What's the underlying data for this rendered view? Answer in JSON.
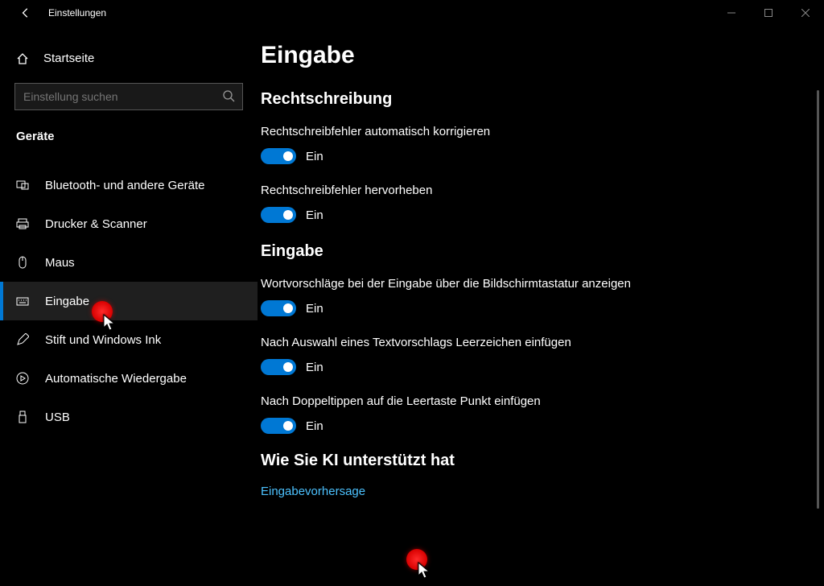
{
  "titlebar": {
    "title": "Einstellungen"
  },
  "sidebar": {
    "home": "Startseite",
    "search_placeholder": "Einstellung suchen",
    "group": "Geräte",
    "items": [
      {
        "label": "Bluetooth- und andere Geräte"
      },
      {
        "label": "Drucker & Scanner"
      },
      {
        "label": "Maus"
      },
      {
        "label": "Eingabe"
      },
      {
        "label": "Stift und Windows Ink"
      },
      {
        "label": "Automatische Wiedergabe"
      },
      {
        "label": "USB"
      }
    ]
  },
  "main": {
    "title": "Eingabe",
    "section_spelling": "Rechtschreibung",
    "spelling_autocorrect": "Rechtschreibfehler automatisch korrigieren",
    "spelling_highlight": "Rechtschreibfehler hervorheben",
    "section_typing": "Eingabe",
    "typing_suggestions": "Wortvorschläge bei der Eingabe über die Bildschirmtastatur anzeigen",
    "typing_space_after": "Nach Auswahl eines Textvorschlags Leerzeichen einfügen",
    "typing_double_tap": "Nach Doppeltippen auf die Leertaste Punkt einfügen",
    "section_ai": "Wie Sie KI unterstützt hat",
    "ai_link": "Eingabevorhersage",
    "toggle_on": "Ein"
  }
}
